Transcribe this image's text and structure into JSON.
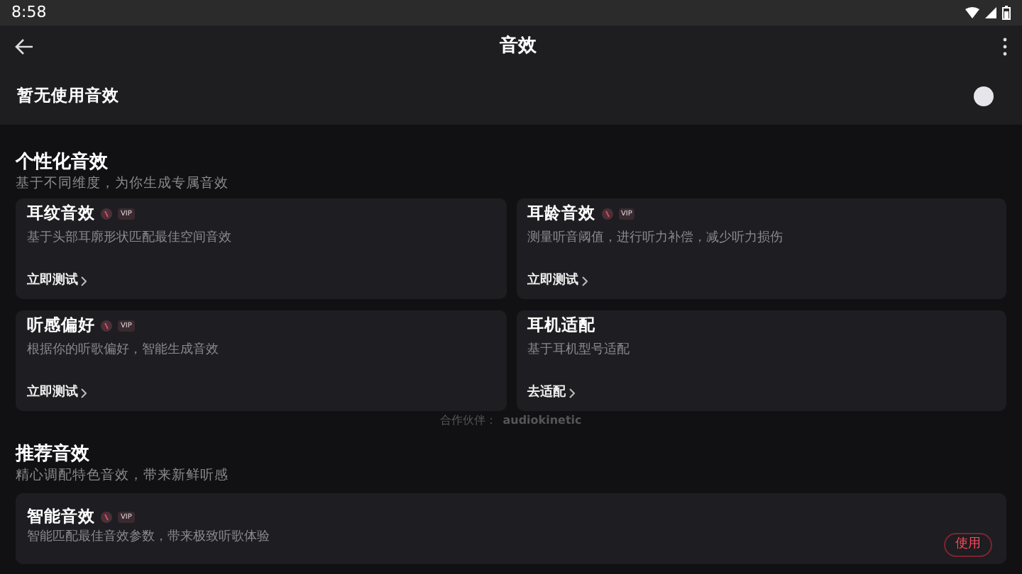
{
  "status_bar": {
    "time": "8:58"
  },
  "app_bar": {
    "title": "音效"
  },
  "current_effect": {
    "label": "暂无使用音效",
    "on": false
  },
  "personalized": {
    "title": "个性化音效",
    "subtitle": "基于不同维度，为你生成专属音效",
    "cards": [
      {
        "title": "耳纹音效",
        "vip": true,
        "vip_label": "VIP",
        "description": "基于头部耳廓形状匹配最佳空间音效",
        "action": "立即测试"
      },
      {
        "title": "耳龄音效",
        "vip": true,
        "vip_label": "VIP",
        "description": "测量听音阈值，进行听力补偿，减少听力损伤",
        "action": "立即测试"
      },
      {
        "title": "听感偏好",
        "vip": true,
        "vip_label": "VIP",
        "description": "根据你的听歌偏好，智能生成音效",
        "action": "立即测试"
      },
      {
        "title": "耳机适配",
        "vip": false,
        "description": "基于耳机型号适配",
        "action": "去适配"
      }
    ],
    "partner": {
      "label": "合作伙伴：",
      "name": "audiokinetic"
    }
  },
  "recommended": {
    "title": "推荐音效",
    "subtitle": "精心调配特色音效，带来新鲜听感",
    "items": [
      {
        "title": "智能音效",
        "vip": true,
        "vip_label": "VIP",
        "description": "智能匹配最佳音效参数，带来极致听歌体验",
        "button": "使用"
      }
    ]
  }
}
